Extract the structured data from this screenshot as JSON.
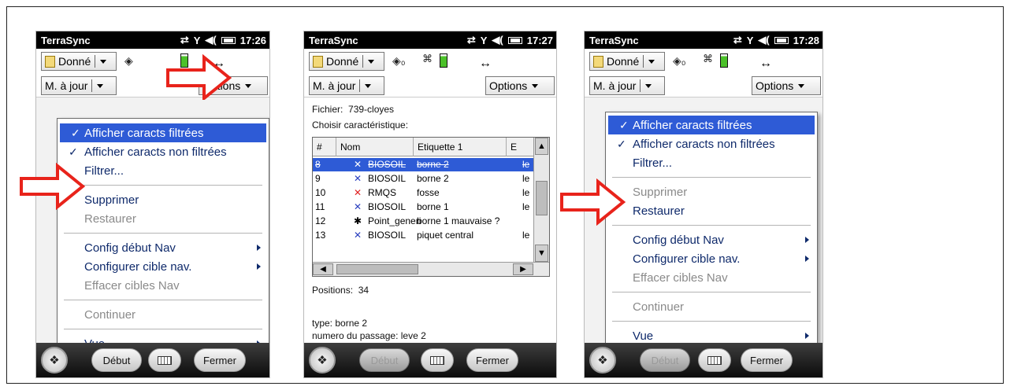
{
  "status": {
    "title": "TerraSync",
    "times": [
      "17:26",
      "17:27",
      "17:28"
    ]
  },
  "toolbar": {
    "data_dropdown": "Donné",
    "update_dropdown": "M. à jour",
    "options_button": "Options"
  },
  "menu": {
    "items": [
      {
        "label": "Afficher caracts filtrées",
        "checked": true
      },
      {
        "label": "Afficher caracts non filtrées",
        "checked": true
      },
      {
        "label": "Filtrer..."
      },
      {
        "label": "Supprimer"
      },
      {
        "label": "Restaurer"
      },
      {
        "label": "Config début Nav",
        "submenu": true
      },
      {
        "label": "Configurer cible nav.",
        "submenu": true
      },
      {
        "label": "Effacer cibles Nav"
      },
      {
        "label": "Continuer"
      },
      {
        "label": "Vue",
        "submenu": true
      }
    ]
  },
  "features": {
    "file_label": "Fichier:",
    "file_value": "739-cloyes",
    "choose_label": "Choisir caractéristique:",
    "columns": [
      "#",
      "Nom",
      "Etiquette 1",
      "E"
    ],
    "rows": [
      {
        "num": "8",
        "icon": "✕",
        "icon_color": "#ffffff",
        "name": "BIOSOIL",
        "label1": "borne 2",
        "extra": "le",
        "selected": true
      },
      {
        "num": "9",
        "icon": "✕",
        "icon_color": "#2a3fbf",
        "name": "BIOSOIL",
        "label1": "borne 2",
        "extra": "le"
      },
      {
        "num": "10",
        "icon": "✕",
        "icon_color": "#e02020",
        "name": "RMQS",
        "label1": "fosse",
        "extra": "le"
      },
      {
        "num": "11",
        "icon": "✕",
        "icon_color": "#2a3fbf",
        "name": "BIOSOIL",
        "label1": "borne 1",
        "extra": "le"
      },
      {
        "num": "12",
        "icon": "✱",
        "icon_color": "#000000",
        "name": "Point_generi",
        "label1": "borne 1 mauvaise ?",
        "extra": ""
      },
      {
        "num": "13",
        "icon": "✕",
        "icon_color": "#2a3fbf",
        "name": "BIOSOIL",
        "label1": "piquet central",
        "extra": "le"
      }
    ],
    "positions_label": "Positions:",
    "positions_value": "34",
    "type_line": "type: borne 2",
    "passage_line": "numero du passage: leve 2"
  },
  "taskbar": {
    "start_label": "Début",
    "close_label": "Fermer"
  },
  "colors": {
    "highlight": "#2e5bd6",
    "menu_text": "#0f2a6b",
    "arrow": "#e8231b"
  }
}
